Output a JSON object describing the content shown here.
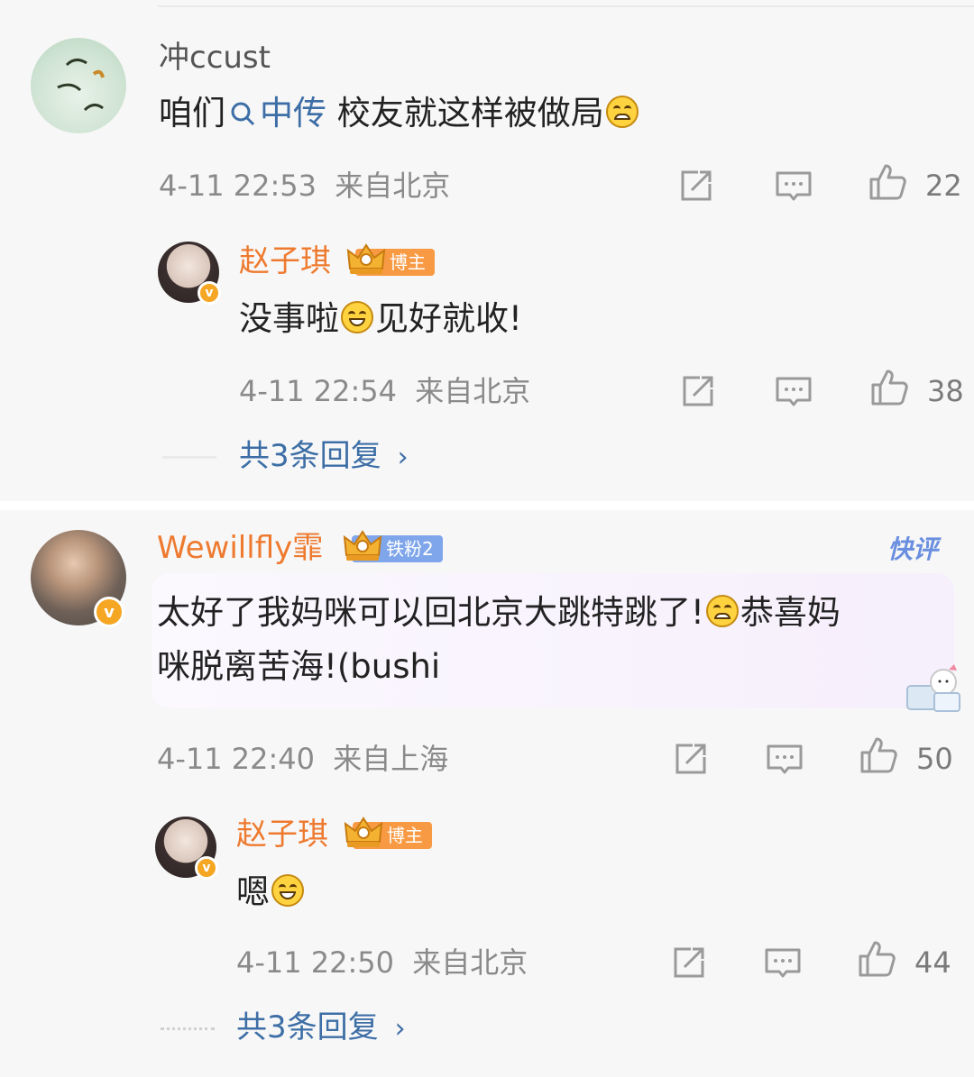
{
  "comment1": {
    "username": "冲ccust",
    "text_prefix": "咱们",
    "topic_link": "中传",
    "text_suffix": " 校友就这样被做局",
    "timestamp": "4-11 22:53",
    "location": "来自北京",
    "likes": "22",
    "reply": {
      "username": "赵子琪",
      "tag": "博主",
      "text_prefix": "没事啦",
      "text_suffix": "见好就收!",
      "timestamp": "4-11 22:54",
      "location": "来自北京",
      "likes": "38"
    },
    "more_replies": "共3条回复"
  },
  "comment2": {
    "username": "Wewillfly霏",
    "tag": "铁粉2",
    "quick_review": "快评",
    "text_line1_prefix": "太好了我妈咪可以回北京大跳特跳了!",
    "text_line1_suffix": "恭喜妈",
    "text_line2": "咪脱离苦海!(bushi",
    "timestamp": "4-11 22:40",
    "location": "来自上海",
    "likes": "50",
    "reply": {
      "username": "赵子琪",
      "tag": "博主",
      "text_prefix": "嗯",
      "timestamp": "4-11 22:50",
      "location": "来自北京",
      "likes": "44"
    },
    "more_replies": "共3条回复"
  },
  "icons": [
    "search-icon",
    "repost-icon",
    "comment-icon",
    "like-icon",
    "chevron-right-icon",
    "verified-badge-icon",
    "crown-icon",
    "emoji-grin-icon",
    "emoji-cry-icon"
  ],
  "colors": {
    "link": "#3d6ea6",
    "username_orange": "#ee7a2f",
    "tag_blogger": "#f89a44",
    "tag_fan": "#7fa6ea",
    "meta": "#8a8a8a"
  }
}
